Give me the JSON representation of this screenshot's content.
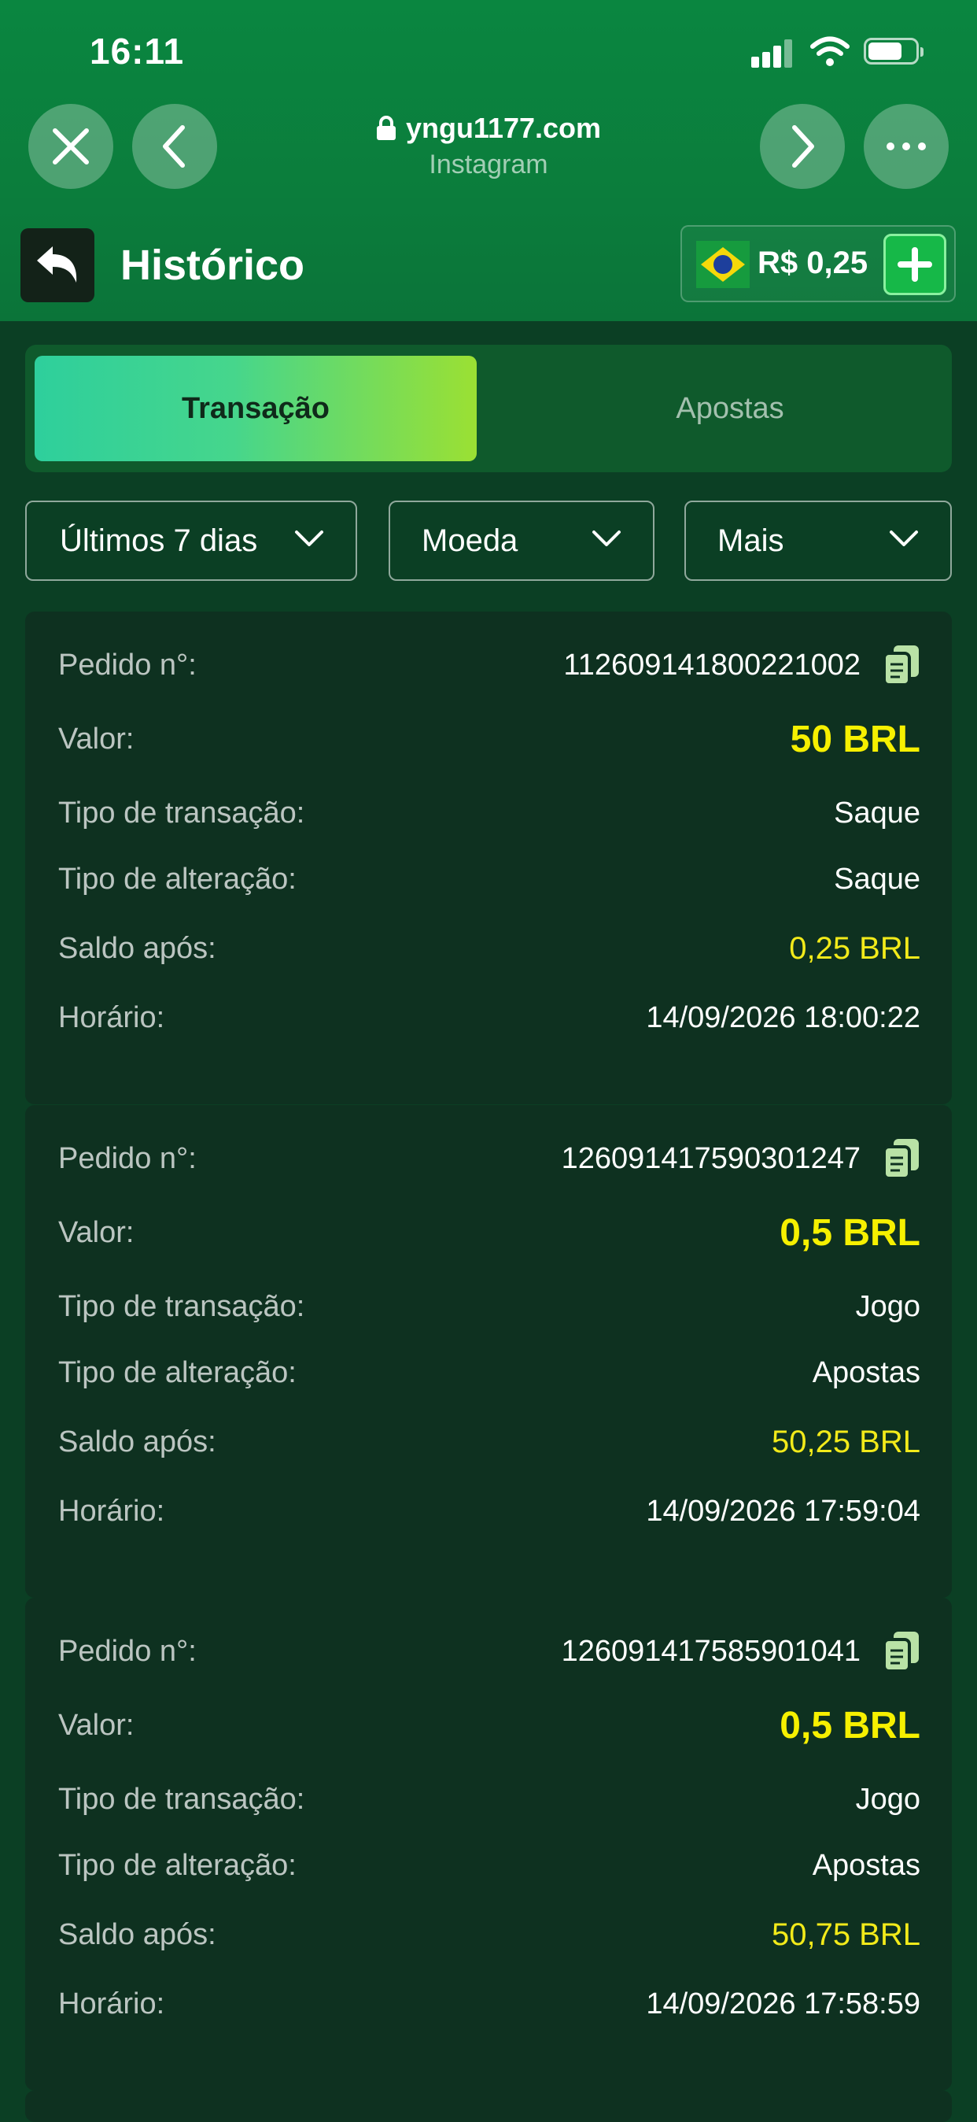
{
  "status": {
    "time": "16:11",
    "battery_level": 0.72
  },
  "browser": {
    "url": "yngu1177.com",
    "subtitle": "Instagram"
  },
  "header": {
    "title": "Histórico",
    "balance": "R$ 0,25"
  },
  "tabs": [
    {
      "label": "Transação",
      "active": true
    },
    {
      "label": "Apostas",
      "active": false
    }
  ],
  "filters": [
    {
      "label": "Últimos 7 dias"
    },
    {
      "label": "Moeda"
    },
    {
      "label": "Mais"
    }
  ],
  "labels": {
    "order": "Pedido n°:",
    "value": "Valor:",
    "tx_type": "Tipo de transação:",
    "change_type": "Tipo de alteração:",
    "balance_after": "Saldo após:",
    "time": "Horário:"
  },
  "transactions": [
    {
      "order": "112609141800221002",
      "value": "50 BRL",
      "tx_type": "Saque",
      "change_type": "Saque",
      "balance_after": "0,25 BRL",
      "time": "14/09/2026 18:00:22"
    },
    {
      "order": "126091417590301247",
      "value": "0,5 BRL",
      "tx_type": "Jogo",
      "change_type": "Apostas",
      "balance_after": "50,25 BRL",
      "time": "14/09/2026 17:59:04"
    },
    {
      "order": "126091417585901041",
      "value": "0,5 BRL",
      "tx_type": "Jogo",
      "change_type": "Apostas",
      "balance_after": "50,75 BRL",
      "time": "14/09/2026 17:58:59"
    }
  ],
  "colors": {
    "accent_yellow": "#f6f000",
    "brand_green": "#0a8640",
    "card_bg": "#0e3120"
  },
  "icons": [
    "close-icon",
    "chevron-left-icon",
    "chevron-right-icon",
    "more-icon",
    "lock-icon",
    "back-arrow-icon",
    "brazil-flag-icon",
    "plus-icon",
    "chevron-down-icon",
    "copy-icon"
  ]
}
